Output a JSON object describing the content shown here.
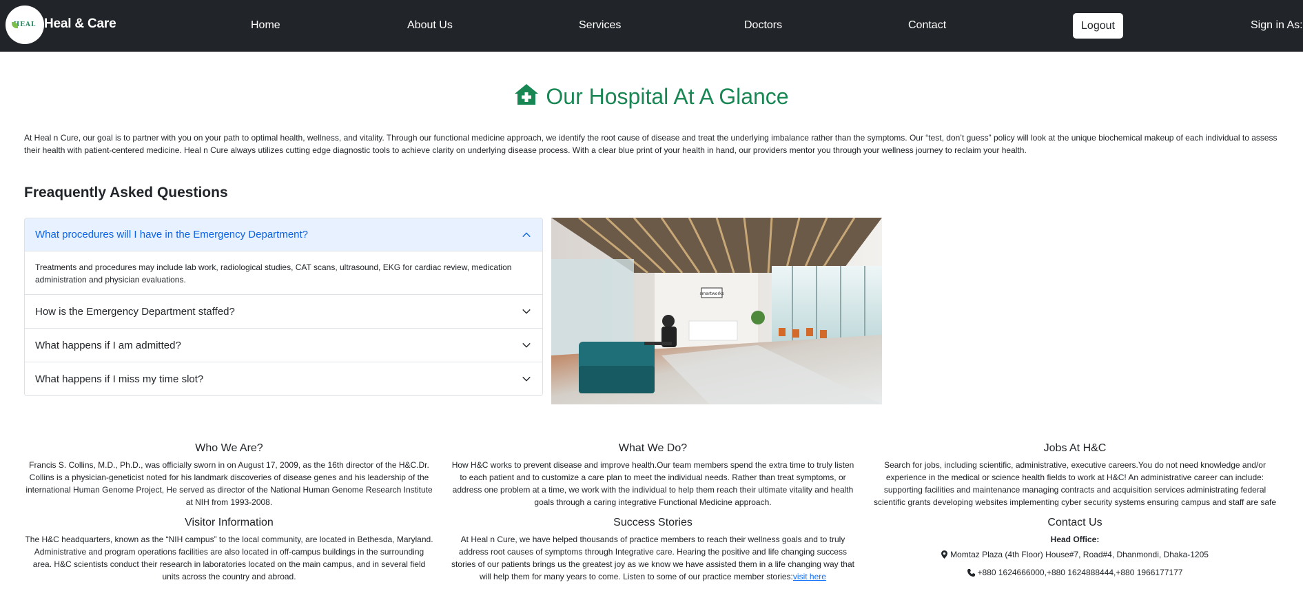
{
  "nav": {
    "logo_text": "HEAL",
    "brand": "Heal & Care",
    "links": [
      "Home",
      "About Us",
      "Services",
      "Doctors",
      "Contact"
    ],
    "logout": "Logout",
    "signin": "Sign in As:"
  },
  "hero": {
    "title": "Our Hospital At A Glance",
    "intro": "At Heal n Cure, our goal is to partner with you on your path to optimal health, wellness, and vitality. Through our functional medicine approach, we identify the root cause of disease and treat the underlying imbalance rather than the symptoms. Our “test, don’t guess” policy will look at the unique biochemical makeup of each individual to assess their health with patient-centered medicine. Heal n Cure always utilizes cutting edge diagnostic tools to achieve clarity on underlying disease process. With a clear blue print of your health in hand, our providers mentor you through your wellness journey to reclaim your health."
  },
  "faq": {
    "heading": "Freaquently Asked Questions",
    "items": [
      {
        "question": "What procedures will I have in the Emergency Department?",
        "answer": "Treatments and procedures may include lab work, radiological studies, CAT scans, ultrasound, EKG for cardiac review, medication administration and physician evaluations.",
        "open": true
      },
      {
        "question": "How is the Emergency Department staffed?",
        "open": false
      },
      {
        "question": "What happens if I am admitted?",
        "open": false
      },
      {
        "question": "What happens if I miss my time slot?",
        "open": false
      }
    ]
  },
  "image": {
    "sign_text": "smartworks"
  },
  "footer": {
    "who": {
      "title": "Who We Are?",
      "text": "Francis S. Collins, M.D., Ph.D., was officially sworn in on August 17, 2009, as the 16th director of the H&C.Dr. Collins is a physician-geneticist noted for his landmark discoveries of disease genes and his leadership of the international Human Genome Project, He served as director of the National Human Genome Research Institute at NIH from 1993-2008."
    },
    "what": {
      "title": "What We Do?",
      "text": "How H&C works to prevent disease and improve health.Our team members spend the extra time to truly listen to each patient and to customize a care plan to meet the individual needs. Rather than treat symptoms, or address one problem at a time, we work with the individual to help them reach their ultimate vitality and health goals through a caring integrative Functional Medicine approach."
    },
    "jobs": {
      "title": "Jobs At H&C",
      "text": "Search for jobs, including scientific, administrative, executive careers.You do not need knowledge and/or experience in the medical or science health fields to work at H&C! An administrative career can include: supporting facilities and maintenance managing contracts and acquisition services administrating federal scientific grants developing websites implementing cyber security systems ensuring campus and staff are safe"
    },
    "visitor": {
      "title": "Visitor Information",
      "text": "The H&C headquarters, known as the “NIH campus” to the local community, are located in Bethesda, Maryland. Administrative and program operations facilities are also located in off-campus buildings in the surrounding area. H&C scientists conduct their research in laboratories located on the main campus, and in several field units across the country and abroad."
    },
    "success": {
      "title": "Success Stories",
      "text": "At Heal n Cure, we have helped thousands of practice members to reach their wellness goals and to truly address root causes of symptoms through Integrative care. Hearing the positive and life changing success stories of our patients brings us the greatest joy as we know we have assisted them in a life changing way that will help them for many years to come. Listen to some of our practice member stories:",
      "link": "visit here"
    },
    "contact": {
      "title": "Contact Us",
      "head_office": "Head Office:",
      "address": "Momtaz Plaza (4th Floor) House#7, Road#4, Dhanmondi, Dhaka-1205",
      "phone": "+880 1624666000,+880 1624888444,+880 1966177177"
    }
  },
  "colors": {
    "navbar": "#212529",
    "accent_green": "#198754",
    "accordion_open_bg": "#e7f1ff",
    "accordion_open_text": "#0c63e4",
    "link": "#0d6efd"
  },
  "icons": {
    "hero": "hospital-icon",
    "accordion_open": "chevron-up-icon",
    "accordion_closed": "chevron-down-icon",
    "address": "map-marker-icon",
    "phone": "phone-icon"
  }
}
